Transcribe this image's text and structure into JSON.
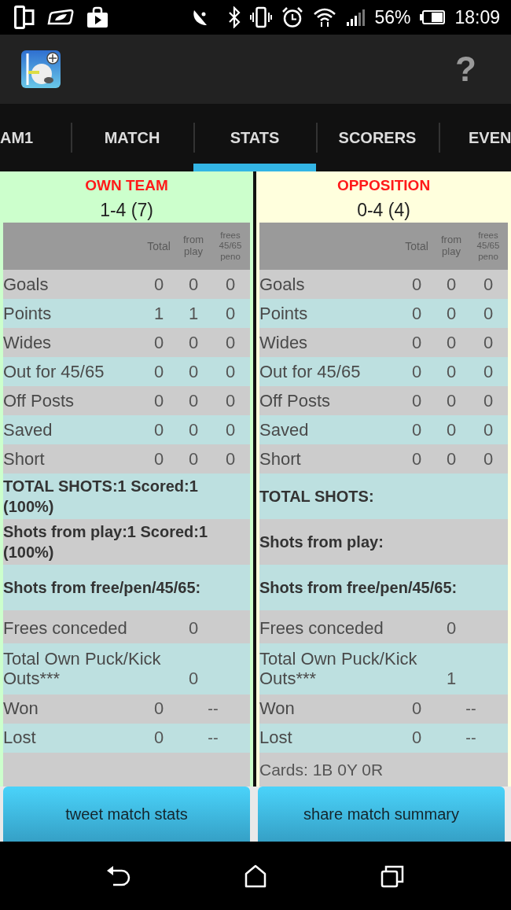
{
  "status_bar": {
    "battery": "56%",
    "time": "18:09"
  },
  "app_bar": {
    "help": "?"
  },
  "tabs": [
    {
      "label": "AM1",
      "selected": false
    },
    {
      "label": "MATCH",
      "selected": false
    },
    {
      "label": "STATS",
      "selected": true
    },
    {
      "label": "SCORERS",
      "selected": false
    },
    {
      "label": "EVEN",
      "selected": false
    }
  ],
  "panels": [
    {
      "title": "OWN TEAM",
      "score": "1-4 (7)",
      "color": "#ccffcc",
      "columns": [
        "Total",
        "from play",
        "frees 45/65 peno"
      ],
      "rows": [
        {
          "kind": "stat",
          "label": "Goals",
          "values": [
            "0",
            "0",
            "0"
          ]
        },
        {
          "kind": "stat",
          "label": "Points",
          "values": [
            "1",
            "1",
            "0"
          ]
        },
        {
          "kind": "stat",
          "label": "Wides",
          "values": [
            "0",
            "0",
            "0"
          ]
        },
        {
          "kind": "stat",
          "label": "Out for 45/65",
          "values": [
            "0",
            "0",
            "0"
          ]
        },
        {
          "kind": "stat",
          "label": "Off Posts",
          "values": [
            "0",
            "0",
            "0"
          ]
        },
        {
          "kind": "stat",
          "label": "Saved",
          "values": [
            "0",
            "0",
            "0"
          ]
        },
        {
          "kind": "stat",
          "label": "Short",
          "values": [
            "0",
            "0",
            "0"
          ]
        },
        {
          "kind": "summary",
          "text": "TOTAL SHOTS:1 Scored:1 (100%)"
        },
        {
          "kind": "summary",
          "text": "Shots from play:1 Scored:1 (100%)"
        },
        {
          "kind": "summary",
          "text": "Shots from free/pen/45/65:"
        },
        {
          "kind": "single",
          "label": "Frees conceded",
          "value": "0"
        },
        {
          "kind": "single",
          "label": "Total Own Puck/Kick Outs***",
          "value": "0"
        },
        {
          "kind": "pair",
          "label": "Won",
          "value": "0",
          "extra": "--"
        },
        {
          "kind": "pair",
          "label": "Lost",
          "value": "0",
          "extra": "--"
        }
      ]
    },
    {
      "title": "OPPOSITION",
      "score": "0-4 (4)",
      "color": "#ffffdd",
      "columns": [
        "Total",
        "from play",
        "frees 45/65 peno"
      ],
      "rows": [
        {
          "kind": "stat",
          "label": "Goals",
          "values": [
            "0",
            "0",
            "0"
          ]
        },
        {
          "kind": "stat",
          "label": "Points",
          "values": [
            "0",
            "0",
            "0"
          ]
        },
        {
          "kind": "stat",
          "label": "Wides",
          "values": [
            "0",
            "0",
            "0"
          ]
        },
        {
          "kind": "stat",
          "label": "Out for 45/65",
          "values": [
            "0",
            "0",
            "0"
          ]
        },
        {
          "kind": "stat",
          "label": "Off Posts",
          "values": [
            "0",
            "0",
            "0"
          ]
        },
        {
          "kind": "stat",
          "label": "Saved",
          "values": [
            "0",
            "0",
            "0"
          ]
        },
        {
          "kind": "stat",
          "label": "Short",
          "values": [
            "0",
            "0",
            "0"
          ]
        },
        {
          "kind": "summary",
          "text": "TOTAL SHOTS:"
        },
        {
          "kind": "summary",
          "text": "Shots from play:"
        },
        {
          "kind": "summary",
          "text": "Shots from free/pen/45/65:"
        },
        {
          "kind": "single",
          "label": "Frees conceded",
          "value": "0"
        },
        {
          "kind": "single",
          "label": "Total Own Puck/Kick Outs***",
          "value": "1"
        },
        {
          "kind": "pair",
          "label": "Won",
          "value": "0",
          "extra": "--"
        },
        {
          "kind": "pair",
          "label": "Lost",
          "value": "0",
          "extra": "--"
        },
        {
          "kind": "note",
          "text": "Cards: 1B 0Y 0R"
        }
      ]
    }
  ],
  "buttons": [
    "tweet match stats",
    "share match summary"
  ]
}
